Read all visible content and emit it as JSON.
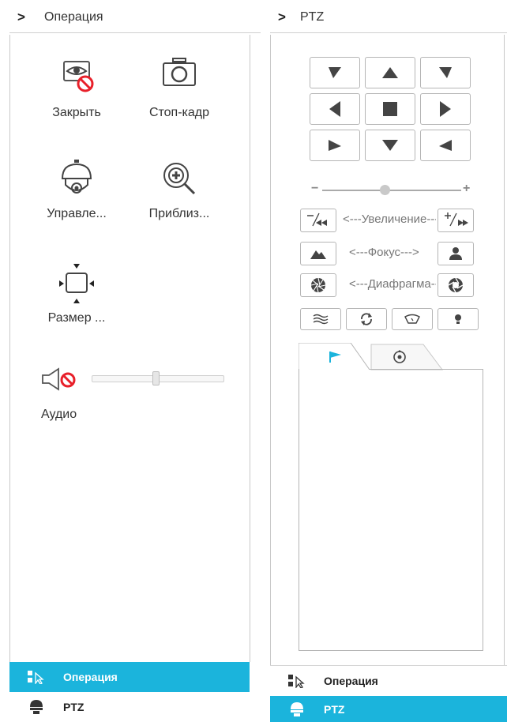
{
  "left_panel": {
    "header": {
      "chevron": ">",
      "title": "Операция"
    },
    "tiles": [
      {
        "label": "Закрыть",
        "icon": "eye-hide-icon"
      },
      {
        "label": "Стоп-кадр",
        "icon": "camera-icon"
      },
      {
        "label": "Управле...",
        "icon": "ptz-camera-icon"
      },
      {
        "label": "Приблиз...",
        "icon": "zoom-in-icon"
      },
      {
        "label": "Размер ...",
        "icon": "resize-icon"
      }
    ],
    "audio": {
      "label": "Аудио",
      "icon": "speaker-muted-icon",
      "volume_fraction": 0.46
    }
  },
  "right_panel": {
    "header": {
      "chevron": ">",
      "title": "PTZ"
    },
    "speed": {
      "minus": "−",
      "plus": "+",
      "fraction": 0.45
    },
    "rows": [
      {
        "label": "<---Увеличение--->",
        "left_icon": "zoom-out-icon",
        "right_icon": "zoom-in-icon",
        "left_text": "−⁄◂◂",
        "right_text": "+⁄▸▸"
      },
      {
        "label": "<---Фокус--->",
        "left_icon": "focus-near-icon",
        "right_icon": "focus-far-icon"
      },
      {
        "label": "<---Диафрагма--->",
        "left_icon": "iris-close-icon",
        "right_icon": "iris-open-icon"
      }
    ],
    "tools": [
      "wiper-icon",
      "rotate-icon",
      "lens-icon",
      "light-icon"
    ],
    "tabs": [
      "preset-flag-icon",
      "patrol-icon"
    ]
  },
  "nav": {
    "operation_label": "Операция",
    "ptz_label": "PTZ"
  },
  "colors": {
    "accent": "#1bb4dc",
    "alert": "#e8202a",
    "border": "#b5b5b5"
  }
}
